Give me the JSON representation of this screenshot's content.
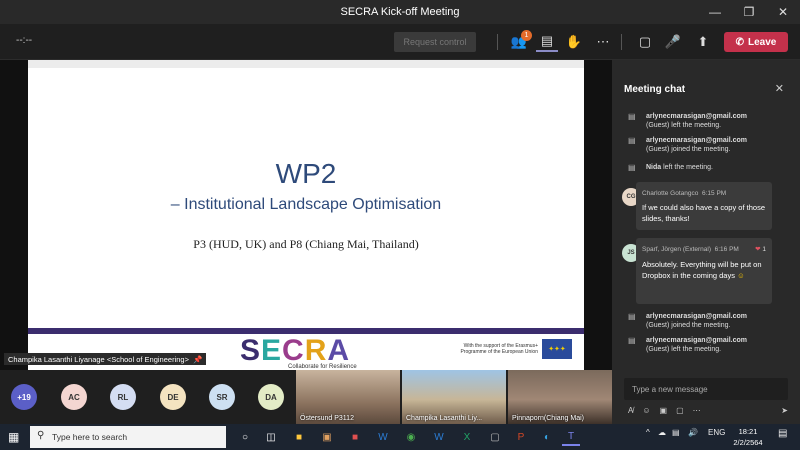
{
  "window": {
    "title": "SECRA Kick-off Meeting",
    "minimize_icon": "minimize-icon",
    "maximize_icon": "maximize-icon",
    "close_icon": "close-icon"
  },
  "toolbar": {
    "timer": "--:--",
    "request_control_label": "Request control",
    "participants_badge": "1",
    "leave_label": "Leave",
    "leave_color": "#c4314b"
  },
  "slide": {
    "title": "WP2",
    "subtitle": "– Institutional Landscape Optimisation",
    "partners": "P3 (HUD, UK) and P8 (Chiang Mai, Thailand)",
    "logo": "SECRA",
    "tagline": "Collaborate for Resilience",
    "erasmus_text": "With the support of the Erasmus+ Programme of the European Union",
    "presenter": "Champika Lasanthi Liyanage <School of Engineering>"
  },
  "chat": {
    "header": "Meeting chat",
    "system_messages": [
      {
        "name": "arlynecmarasigan@gmail.com",
        "rest": "(Guest) left the meeting."
      },
      {
        "name": "arlynecmarasigan@gmail.com",
        "rest": "(Guest) joined the meeting."
      },
      {
        "name": "Nida",
        "rest": "left the meeting."
      }
    ],
    "messages": [
      {
        "initials": "CG",
        "author": "Charlotte Gotangco",
        "time": "6:15 PM",
        "text": "If we could also have a copy of those slides, thanks!"
      },
      {
        "initials": "JS",
        "author": "Sparf, Jörgen (External)",
        "time": "6:16 PM",
        "text": "Absolutely. Everything will be put on Dropbox in the coming days",
        "reaction_count": "1"
      }
    ],
    "system_messages_after": [
      {
        "name": "arlynecmarasigan@gmail.com",
        "rest": "(Guest) joined the meeting."
      },
      {
        "name": "arlynecmarasigan@gmail.com",
        "rest": "(Guest) left the meeting."
      }
    ],
    "compose_placeholder": "Type a new message"
  },
  "roster": {
    "overflow": "+19",
    "participants": [
      "AC",
      "RL",
      "DE",
      "SR",
      "DA"
    ],
    "video_tiles": [
      "Östersund P3112",
      "Champika Lasanthi Liy...",
      "Pinnaporn(Chiang Mai)"
    ]
  },
  "taskbar": {
    "search_placeholder": "Type here to search",
    "language": "ENG",
    "time": "18:21",
    "date": "2/2/2564"
  }
}
